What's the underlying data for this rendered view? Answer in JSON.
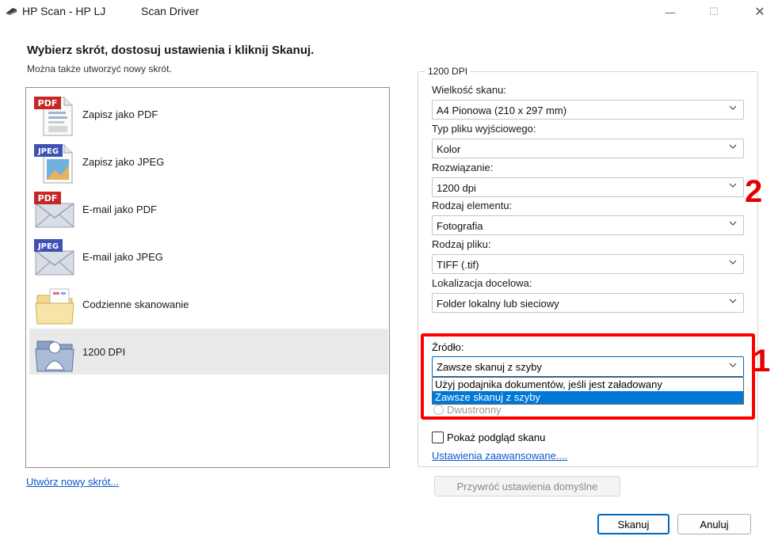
{
  "window": {
    "title": "HP Scan - HP LJ",
    "title_extra": "Scan Driver",
    "minimize_glyph": "—",
    "maximize_glyph": "☐",
    "close_glyph": "✕"
  },
  "heading": "Wybierz skrót, dostosuj ustawienia i kliknij Skanuj.",
  "subheading": "Można także utworzyć nowy skrót.",
  "shortcuts": [
    {
      "label": "Zapisz jako PDF",
      "badge": "PDF",
      "icon": "pdf-document-icon"
    },
    {
      "label": "Zapisz jako JPEG",
      "badge": "JPEG",
      "icon": "jpeg-image-icon"
    },
    {
      "label": "E-mail jako PDF",
      "badge": "PDF",
      "icon": "pdf-email-icon"
    },
    {
      "label": "E-mail jako JPEG",
      "badge": "JPEG",
      "icon": "jpeg-email-icon"
    },
    {
      "label": "Codzienne skanowanie",
      "badge": "",
      "icon": "folder-icon"
    },
    {
      "label": "1200 DPI",
      "badge": "",
      "icon": "scan-photo-icon",
      "selected": true
    }
  ],
  "new_shortcut_link": "Utwórz nowy skrót...",
  "settings": {
    "group_title": "1200 DPI",
    "fields": [
      {
        "label": "Wielkość skanu:",
        "value": "A4 Pionowa (210 x 297 mm)"
      },
      {
        "label": "Typ pliku wyjściowego:",
        "value": "Kolor"
      },
      {
        "label": "Rozwiązanie:",
        "value": "1200 dpi"
      },
      {
        "label": "Rodzaj elementu:",
        "value": "Fotografia"
      },
      {
        "label": "Rodzaj pliku:",
        "value": "TIFF (.tif)"
      },
      {
        "label": "Lokalizacja docelowa:",
        "value": "Folder lokalny lub sieciowy"
      }
    ],
    "source": {
      "label": "Źródło:",
      "value": "Zawsze skanuj z szyby",
      "options": [
        "Użyj podajnika dokumentów, jeśli jest załadowany",
        "Zawsze skanuj z szyby"
      ],
      "highlighted_index": 1
    },
    "duplex_label": "Dwustronny",
    "preview_label": "Pokaż podgląd skanu",
    "preview_checked": false,
    "advanced_link": "Ustawienia zaawansowane...."
  },
  "annotations": {
    "callout_1": "1",
    "callout_2": "2",
    "color": "#e30000"
  },
  "buttons": {
    "restore": "Przywróć ustawienia domyślne",
    "scan": "Skanuj",
    "cancel": "Anuluj"
  }
}
